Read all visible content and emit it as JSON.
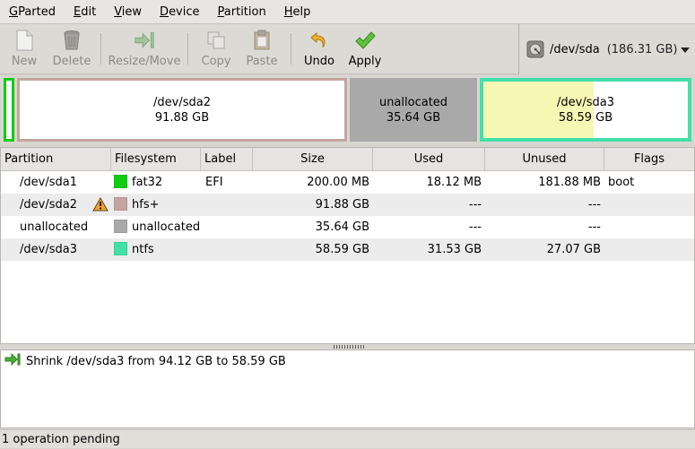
{
  "menu": [
    {
      "mnemonic": "G",
      "rest": "Parted"
    },
    {
      "mnemonic": "E",
      "rest": "dit"
    },
    {
      "mnemonic": "V",
      "rest": "iew"
    },
    {
      "mnemonic": "D",
      "rest": "evice"
    },
    {
      "mnemonic": "P",
      "rest": "artition"
    },
    {
      "mnemonic": "H",
      "rest": "elp"
    }
  ],
  "toolbar": {
    "new_label": "New",
    "delete_label": "Delete",
    "resize_label": "Resize/Move",
    "copy_label": "Copy",
    "paste_label": "Paste",
    "undo_label": "Undo",
    "apply_label": "Apply"
  },
  "device": {
    "name": "/dev/sda",
    "size": "(186.31 GB)"
  },
  "graph": {
    "sda2": {
      "name": "/dev/sda2",
      "size": "91.88 GB",
      "color": "#c4a4a0"
    },
    "unallocated": {
      "name": "unallocated",
      "size": "35.64 GB",
      "color": "#a9a9a9"
    },
    "sda3": {
      "name": "/dev/sda3",
      "size": "58.59 GB",
      "color": "#40e0a8",
      "used_fraction": 0.54
    },
    "sda1_color": "#11cc11"
  },
  "table": {
    "headers": {
      "partition": "Partition",
      "filesystem": "Filesystem",
      "label": "Label",
      "size": "Size",
      "used": "Used",
      "unused": "Unused",
      "flags": "Flags"
    },
    "rows": [
      {
        "partition": "/dev/sda1",
        "warning": false,
        "fs": "fat32",
        "fs_color": "#11cc11",
        "label": "EFI",
        "size": "200.00 MB",
        "used": "18.12 MB",
        "unused": "181.88 MB",
        "flags": "boot"
      },
      {
        "partition": "/dev/sda2",
        "warning": true,
        "fs": "hfs+",
        "fs_color": "#c4a4a0",
        "label": "",
        "size": "91.88 GB",
        "used": "---",
        "unused": "---",
        "flags": ""
      },
      {
        "partition": "unallocated",
        "warning": false,
        "fs": "unallocated",
        "fs_color": "#a9a9a9",
        "label": "",
        "size": "35.64 GB",
        "used": "---",
        "unused": "---",
        "flags": ""
      },
      {
        "partition": "/dev/sda3",
        "warning": false,
        "fs": "ntfs",
        "fs_color": "#40e0a8",
        "label": "",
        "size": "58.59 GB",
        "used": "31.53 GB",
        "unused": "27.07 GB",
        "flags": ""
      }
    ]
  },
  "operations": [
    {
      "text": "Shrink /dev/sda3 from 94.12 GB to 58.59 GB",
      "icon": "resize-icon"
    }
  ],
  "status": "1 operation pending"
}
